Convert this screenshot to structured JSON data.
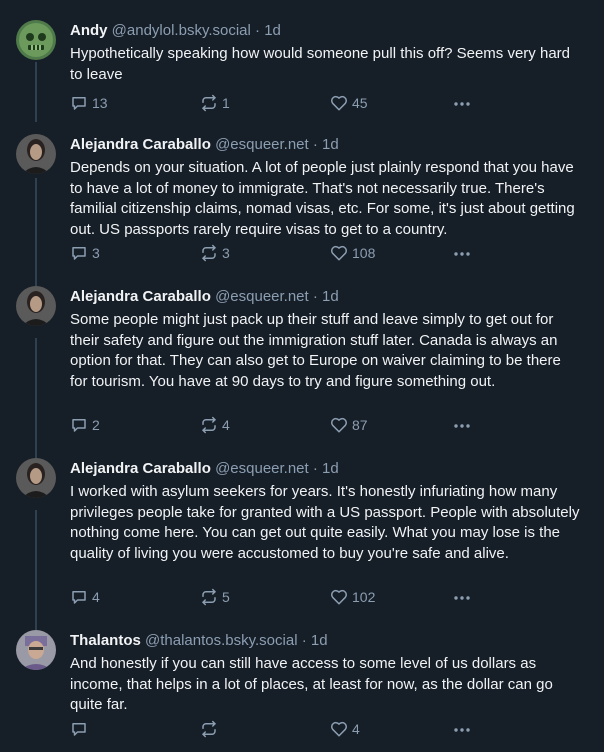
{
  "posts": [
    {
      "name": "Andy",
      "handle": "@andylol.bsky.social",
      "dot": "·",
      "age": "1d",
      "text": "Hypothetically speaking how would someone pull this off? Seems very hard to leave",
      "replies": "13",
      "reposts": "1",
      "likes": "45"
    },
    {
      "name": "Alejandra Caraballo",
      "handle": "@esqueer.net",
      "dot": "·",
      "age": "1d",
      "text": "Depends on your situation. A lot of people just plainly respond that you have to have a lot of money to immigrate. That's not necessarily true. There's familial citizenship claims, nomad visas, etc. For some, it's just about getting out. US passports rarely require visas to get to a country.",
      "replies": "3",
      "reposts": "3",
      "likes": "108"
    },
    {
      "name": "Alejandra Caraballo",
      "handle": "@esqueer.net",
      "dot": "·",
      "age": "1d",
      "text": "Some people might just pack up their stuff and leave simply to get out for their safety and figure out the immigration stuff later. Canada is always an option for that. They can also get to Europe on waiver claiming to be there for tourism. You have at 90 days to try and figure something out.",
      "replies": "2",
      "reposts": "4",
      "likes": "87"
    },
    {
      "name": "Alejandra Caraballo",
      "handle": "@esqueer.net",
      "dot": "·",
      "age": "1d",
      "text": "I worked with asylum seekers for years. It's honestly infuriating how many privileges people take for granted with a US passport. People with absolutely nothing come here. You can get out quite easily. What you may lose is the quality of living you were accustomed to buy you're safe and alive.",
      "replies": "4",
      "reposts": "5",
      "likes": "102"
    },
    {
      "name": "Thalantos",
      "handle": "@thalantos.bsky.social",
      "dot": "·",
      "age": "1d",
      "text": "And honestly if you can still have access to some level of us dollars as income, that helps in a lot of places, at least for now, as the dollar can go quite far.",
      "replies": "",
      "reposts": "",
      "likes": "4"
    }
  ],
  "icons": {
    "reply": "reply-icon",
    "repost": "repost-icon",
    "like": "heart-icon",
    "more": "more-options-icon"
  },
  "colors": {
    "background": "#161e27",
    "text": "#f1f3f5",
    "muted": "#8c9eb2",
    "thread_line": "#2e4052"
  }
}
